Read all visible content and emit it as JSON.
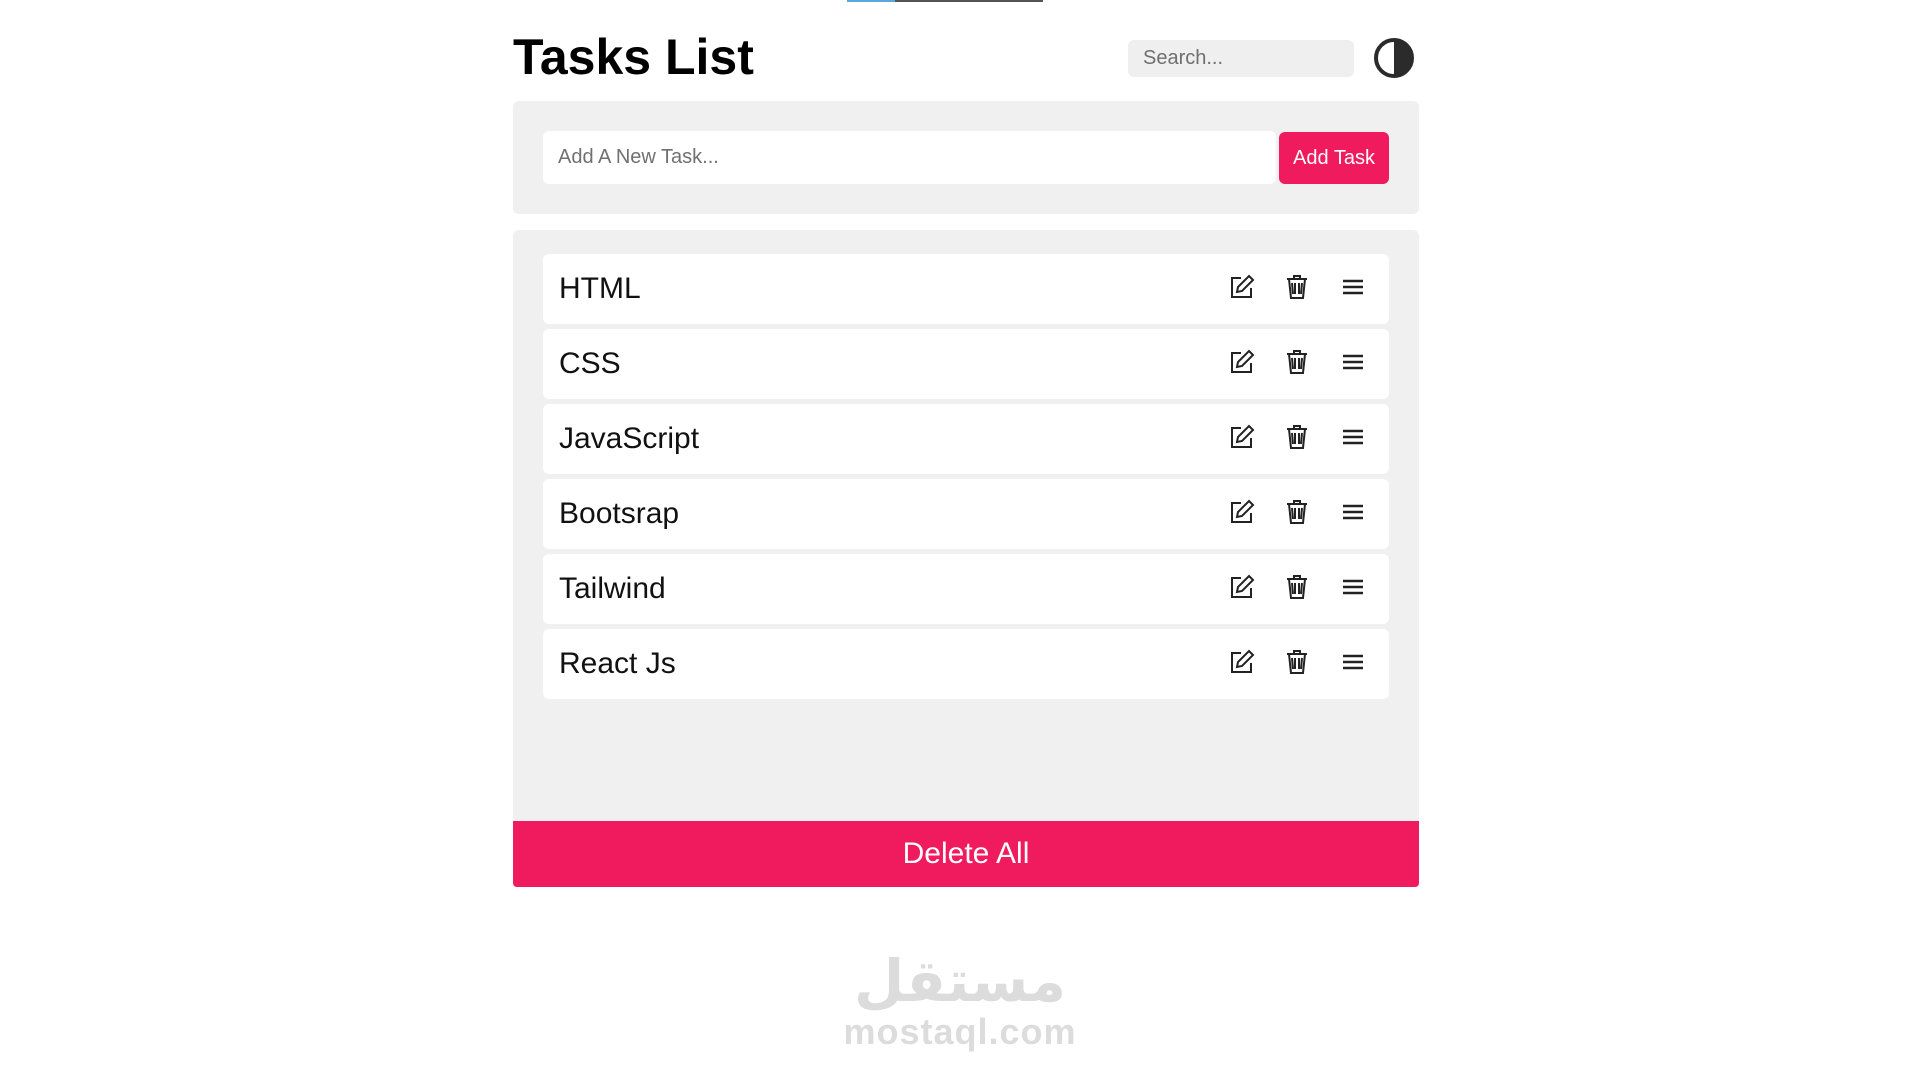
{
  "header": {
    "title": "Tasks List",
    "search_placeholder": "Search...",
    "theme_toggle_icon": "half-circle-contrast-icon"
  },
  "add_task": {
    "placeholder": "Add A New Task...",
    "button_label": "Add Task"
  },
  "tasks": [
    {
      "label": "HTML"
    },
    {
      "label": "CSS"
    },
    {
      "label": "JavaScript"
    },
    {
      "label": "Bootsrap"
    },
    {
      "label": "Tailwind"
    },
    {
      "label": "React Js"
    }
  ],
  "task_icons": [
    "edit-icon",
    "trash-icon",
    "drag-handle-icon"
  ],
  "delete_all_label": "Delete All",
  "watermark": {
    "arabic": "مستقل",
    "latin": "mostaql.com"
  },
  "colors": {
    "accent": "#f01a5e",
    "panel": "#f0f0f0",
    "text": "#111111"
  }
}
